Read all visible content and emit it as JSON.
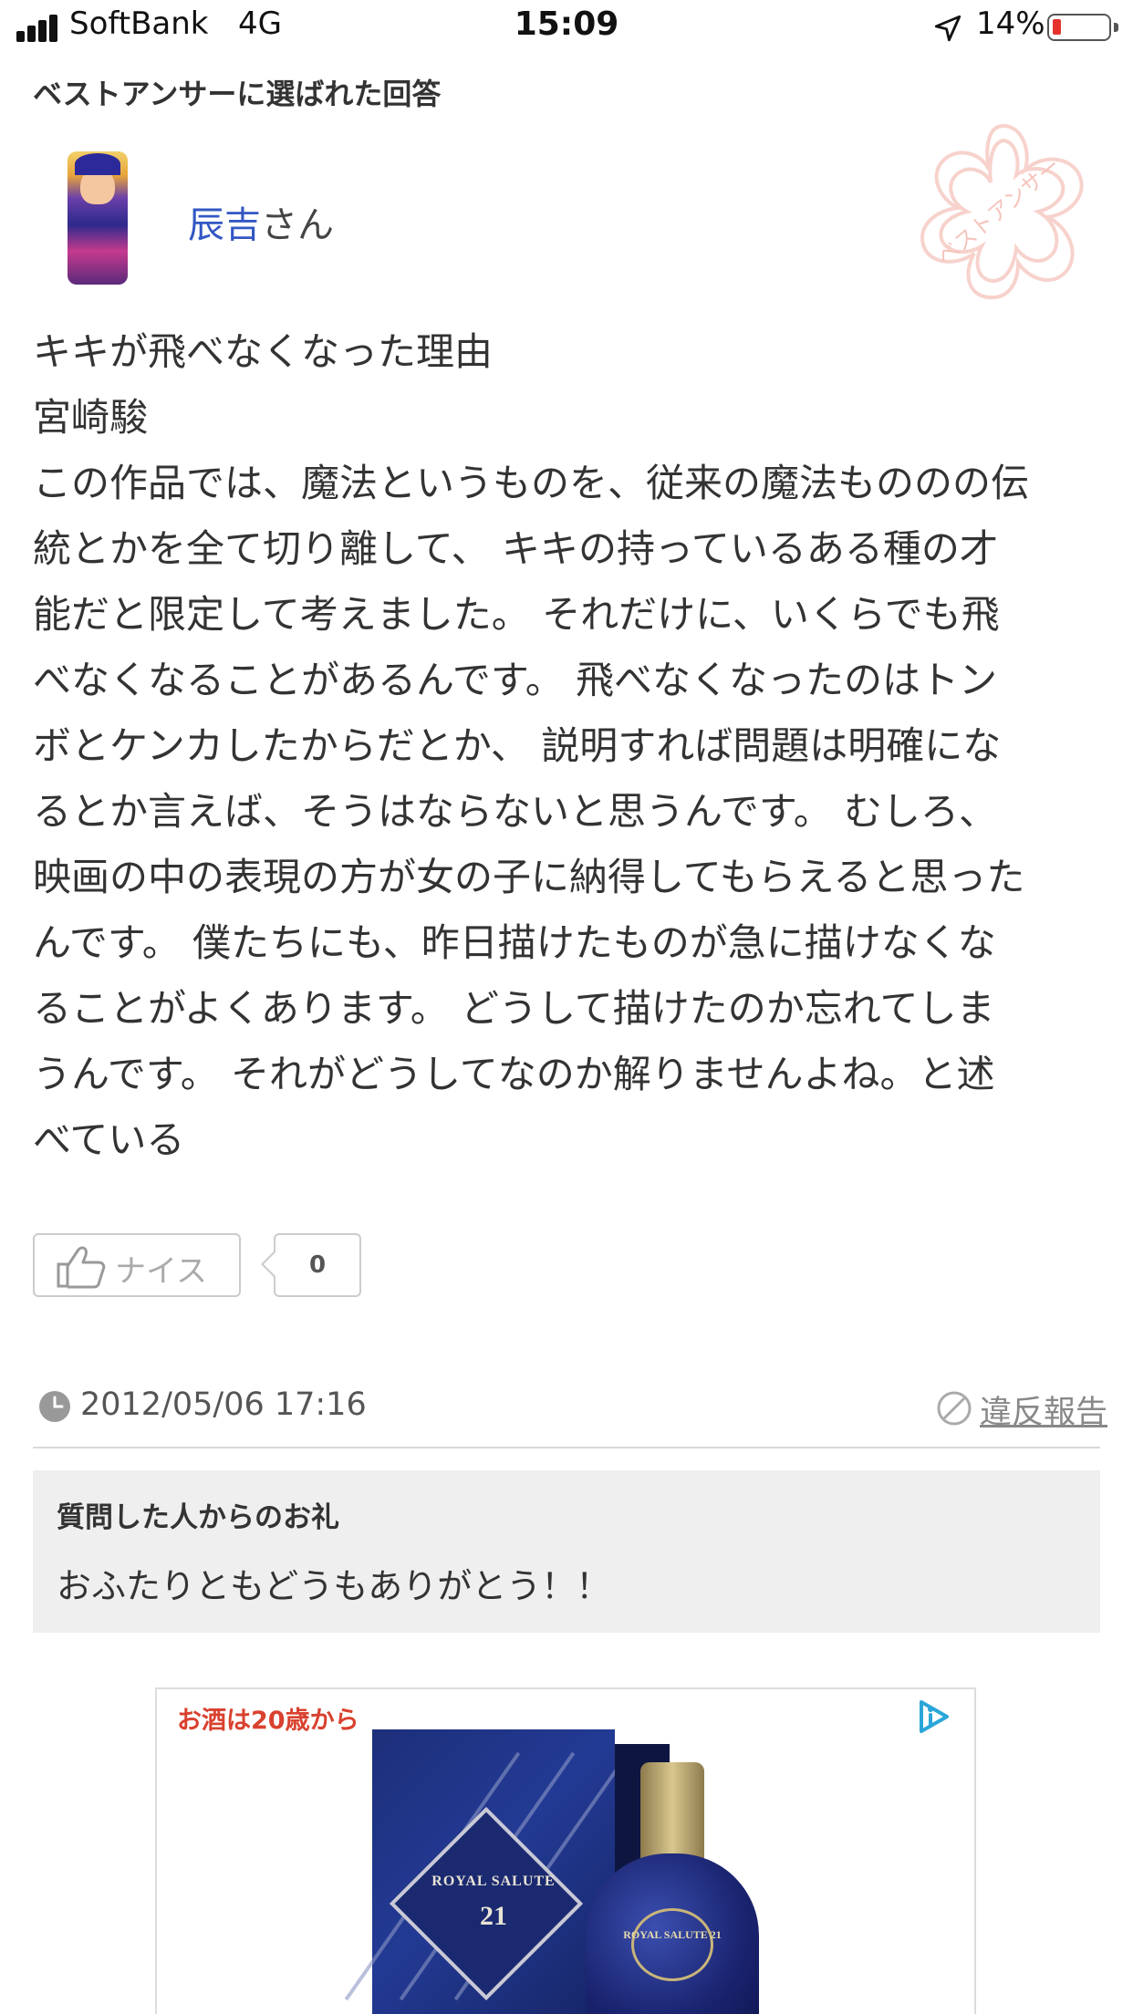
{
  "status_bar": {
    "carrier": "SoftBank",
    "network": "4G",
    "time": "15:09",
    "battery_percent": "14%",
    "battery_level": 0.14,
    "icons": [
      "signal-icon",
      "location-arrow-icon",
      "battery-icon"
    ]
  },
  "section": {
    "title": "ベストアンサーに選ばれた回答"
  },
  "answerer": {
    "name": "辰吉",
    "suffix": "さん",
    "stamp_text": "ベストアンサー"
  },
  "answer": {
    "lines": [
      "キキが飛べなくなった理由",
      "宮崎駿",
      "この作品では、魔法というものを、従来の魔法もののの伝",
      "統とかを全て切り離して、 キキの持っているある種の才",
      "能だと限定して考えました。 それだけに、いくらでも飛",
      "べなくなることがあるんです。 飛べなくなったのはトン",
      "ボとケンカしたからだとか、 説明すれば問題は明確にな",
      "るとか言えば、そうはならないと思うんです。 むしろ、",
      "映画の中の表現の方が女の子に納得してもらえると思った",
      "んです。 僕たちにも、昨日描けたものが急に描けなくな",
      "ることがよくあります。 どうして描けたのか忘れてしま",
      "うんです。 それがどうしてなのか解りませんよね。と述",
      "べている"
    ]
  },
  "reaction": {
    "nice_label": "ナイス",
    "count": "0"
  },
  "meta": {
    "timestamp": "2012/05/06 17:16",
    "report_label": "違反報告"
  },
  "thanks": {
    "title": "質問した人からのお礼",
    "text": "おふたりともどうもありがとう！！"
  },
  "ad": {
    "age_notice": "お酒は20歳から",
    "brand": "ROYAL SALUTE",
    "years": "21",
    "bottle_label": "ROYAL SALUTE 21",
    "colors": {
      "box": "#233a94",
      "notice": "#d9412f",
      "accent_link": "#3358c4"
    }
  }
}
